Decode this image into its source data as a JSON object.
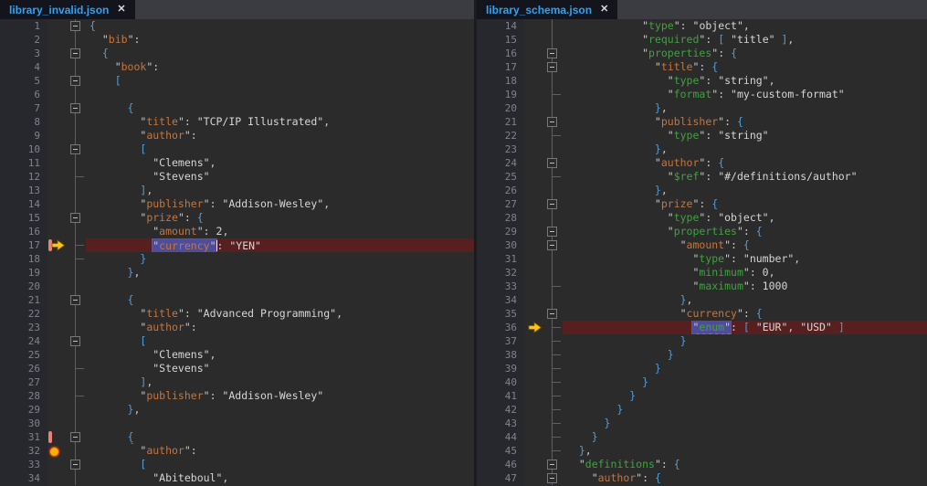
{
  "colors": {
    "editor-bg": "#2b2b2b",
    "gutter-bg": "#27272e",
    "tabstrip-bg": "#3b3b42",
    "tab-bg": "#14141c",
    "tab-text": "#2fa3f2",
    "divider": "#1a1a20",
    "line-number": "#82828e",
    "brace": "#569cd6",
    "key": "#c6763c",
    "schema-key": "#3fa33f",
    "string": "#d6d6d6",
    "punct": "#c9c9c9",
    "number": "#d6d6d6",
    "error-line-bg": "#571f1f",
    "selection-bg": "#4d4d9c",
    "squiggle": "#ff2a2a",
    "fold-line": "#5f5f5f",
    "glyph-bar": "#e8837c",
    "glyph-arrow": "#ffc20e",
    "glyph-dot": "#ffaf00",
    "caret": "#ffffff"
  },
  "panes": [
    {
      "id": "left",
      "tab": {
        "title": "library_invalid.json",
        "close": "✕"
      },
      "lines": [
        {
          "n": 1,
          "ind": 0,
          "fold": "open",
          "tok": [
            [
              "b",
              "{"
            ]
          ]
        },
        {
          "n": 2,
          "ind": 2,
          "tok": [
            [
              "k",
              "bib"
            ],
            [
              "q",
              ":"
            ]
          ]
        },
        {
          "n": 3,
          "ind": 2,
          "fold": "open",
          "tok": [
            [
              "b",
              "{"
            ]
          ]
        },
        {
          "n": 4,
          "ind": 4,
          "tok": [
            [
              "k",
              "book"
            ],
            [
              "q",
              ":"
            ]
          ]
        },
        {
          "n": 5,
          "ind": 4,
          "fold": "open",
          "tok": [
            [
              "b",
              "["
            ]
          ]
        },
        {
          "n": 6,
          "ind": 0,
          "tok": []
        },
        {
          "n": 7,
          "ind": 6,
          "fold": "open",
          "tok": [
            [
              "b",
              "{"
            ]
          ]
        },
        {
          "n": 8,
          "ind": 8,
          "tok": [
            [
              "k",
              "title"
            ],
            [
              "q",
              ": "
            ],
            [
              "v",
              "\"TCP/IP Illustrated\""
            ],
            [
              "q",
              ","
            ]
          ]
        },
        {
          "n": 9,
          "ind": 8,
          "tok": [
            [
              "k",
              "author"
            ],
            [
              "q",
              ":"
            ]
          ]
        },
        {
          "n": 10,
          "ind": 8,
          "fold": "open",
          "tok": [
            [
              "b",
              "["
            ]
          ]
        },
        {
          "n": 11,
          "ind": 10,
          "tok": [
            [
              "v",
              "\"Clemens\""
            ],
            [
              "q",
              ","
            ]
          ]
        },
        {
          "n": 12,
          "ind": 10,
          "fold": "tick",
          "tok": [
            [
              "v",
              "\"Stevens\""
            ]
          ]
        },
        {
          "n": 13,
          "ind": 8,
          "tok": [
            [
              "b",
              "]"
            ],
            [
              "q",
              ","
            ]
          ]
        },
        {
          "n": 14,
          "ind": 8,
          "tok": [
            [
              "k",
              "publisher"
            ],
            [
              "q",
              ": "
            ],
            [
              "v",
              "\"Addison-Wesley\""
            ],
            [
              "q",
              ","
            ]
          ]
        },
        {
          "n": 15,
          "ind": 8,
          "fold": "open",
          "tok": [
            [
              "k",
              "prize"
            ],
            [
              "q",
              ": "
            ],
            [
              "b",
              "{"
            ]
          ]
        },
        {
          "n": 16,
          "ind": 10,
          "tok": [
            [
              "k",
              "amount"
            ],
            [
              "q",
              ": "
            ],
            [
              "d",
              "2"
            ],
            [
              "q",
              ","
            ]
          ]
        },
        {
          "n": 17,
          "ind": 10,
          "fold": "tick",
          "hl": true,
          "glyphs": [
            "bar",
            "arrow"
          ],
          "tok": [
            [
              "k",
              "currency",
              "sel sq"
            ],
            [
              "caret",
              ""
            ],
            [
              "q",
              ": "
            ],
            [
              "v",
              "\"YEN\""
            ]
          ]
        },
        {
          "n": 18,
          "ind": 8,
          "fold": "tick",
          "tok": [
            [
              "b",
              "}"
            ]
          ]
        },
        {
          "n": 19,
          "ind": 6,
          "tok": [
            [
              "b",
              "}"
            ],
            [
              "q",
              ","
            ]
          ]
        },
        {
          "n": 20,
          "ind": 0,
          "tok": []
        },
        {
          "n": 21,
          "ind": 6,
          "fold": "open",
          "tok": [
            [
              "b",
              "{"
            ]
          ]
        },
        {
          "n": 22,
          "ind": 8,
          "tok": [
            [
              "k",
              "title"
            ],
            [
              "q",
              ": "
            ],
            [
              "v",
              "\"Advanced Programming\""
            ],
            [
              "q",
              ","
            ]
          ]
        },
        {
          "n": 23,
          "ind": 8,
          "tok": [
            [
              "k",
              "author"
            ],
            [
              "q",
              ":"
            ]
          ]
        },
        {
          "n": 24,
          "ind": 8,
          "fold": "open",
          "tok": [
            [
              "b",
              "["
            ]
          ]
        },
        {
          "n": 25,
          "ind": 10,
          "tok": [
            [
              "v",
              "\"Clemens\""
            ],
            [
              "q",
              ","
            ]
          ]
        },
        {
          "n": 26,
          "ind": 10,
          "fold": "tick",
          "tok": [
            [
              "v",
              "\"Stevens\""
            ]
          ]
        },
        {
          "n": 27,
          "ind": 8,
          "tok": [
            [
              "b",
              "]"
            ],
            [
              "q",
              ","
            ]
          ]
        },
        {
          "n": 28,
          "ind": 8,
          "fold": "tick",
          "tok": [
            [
              "k",
              "publisher"
            ],
            [
              "q",
              ": "
            ],
            [
              "v",
              "\"Addison-Wesley\""
            ]
          ]
        },
        {
          "n": 29,
          "ind": 6,
          "tok": [
            [
              "b",
              "}"
            ],
            [
              "q",
              ","
            ]
          ]
        },
        {
          "n": 30,
          "ind": 0,
          "tok": []
        },
        {
          "n": 31,
          "ind": 6,
          "fold": "open",
          "glyphs": [
            "bar"
          ],
          "tok": [
            [
              "b",
              "{",
              "sq"
            ]
          ]
        },
        {
          "n": 32,
          "ind": 8,
          "glyphs": [
            "dot"
          ],
          "tok": [
            [
              "k",
              "author"
            ],
            [
              "q",
              ":"
            ]
          ]
        },
        {
          "n": 33,
          "ind": 8,
          "fold": "open",
          "tok": [
            [
              "b",
              "["
            ]
          ]
        },
        {
          "n": 34,
          "ind": 10,
          "tok": [
            [
              "v",
              "\"Abiteboul\""
            ],
            [
              "q",
              ","
            ]
          ]
        }
      ]
    },
    {
      "id": "right",
      "tab": {
        "title": "library_schema.json",
        "close": "✕"
      },
      "lines": [
        {
          "n": 14,
          "ind": 12,
          "tok": [
            [
              "s",
              "type"
            ],
            [
              "q",
              ": "
            ],
            [
              "v",
              "\"object\""
            ],
            [
              "q",
              ","
            ]
          ]
        },
        {
          "n": 15,
          "ind": 12,
          "tok": [
            [
              "s",
              "required"
            ],
            [
              "q",
              ": "
            ],
            [
              "b",
              "["
            ],
            [
              "q",
              " "
            ],
            [
              "v",
              "\"title\""
            ],
            [
              "q",
              " "
            ],
            [
              "b",
              "]"
            ],
            [
              "q",
              ","
            ]
          ]
        },
        {
          "n": 16,
          "ind": 12,
          "fold": "open",
          "tok": [
            [
              "s",
              "properties"
            ],
            [
              "q",
              ": "
            ],
            [
              "b",
              "{"
            ]
          ]
        },
        {
          "n": 17,
          "ind": 14,
          "fold": "open",
          "tok": [
            [
              "k",
              "title"
            ],
            [
              "q",
              ": "
            ],
            [
              "b",
              "{"
            ]
          ]
        },
        {
          "n": 18,
          "ind": 16,
          "tok": [
            [
              "s",
              "type"
            ],
            [
              "q",
              ": "
            ],
            [
              "v",
              "\"string\""
            ],
            [
              "q",
              ","
            ]
          ]
        },
        {
          "n": 19,
          "ind": 16,
          "fold": "tick",
          "tok": [
            [
              "s",
              "format"
            ],
            [
              "q",
              ": "
            ],
            [
              "v",
              "\"my-custom-format\""
            ]
          ]
        },
        {
          "n": 20,
          "ind": 14,
          "tok": [
            [
              "b",
              "}"
            ],
            [
              "q",
              ","
            ]
          ]
        },
        {
          "n": 21,
          "ind": 14,
          "fold": "open",
          "tok": [
            [
              "k",
              "publisher"
            ],
            [
              "q",
              ": "
            ],
            [
              "b",
              "{"
            ]
          ]
        },
        {
          "n": 22,
          "ind": 16,
          "fold": "tick",
          "tok": [
            [
              "s",
              "type"
            ],
            [
              "q",
              ": "
            ],
            [
              "v",
              "\"string\""
            ]
          ]
        },
        {
          "n": 23,
          "ind": 14,
          "tok": [
            [
              "b",
              "}"
            ],
            [
              "q",
              ","
            ]
          ]
        },
        {
          "n": 24,
          "ind": 14,
          "fold": "open",
          "tok": [
            [
              "k",
              "author"
            ],
            [
              "q",
              ": "
            ],
            [
              "b",
              "{"
            ]
          ]
        },
        {
          "n": 25,
          "ind": 16,
          "fold": "tick",
          "tok": [
            [
              "s",
              "$ref"
            ],
            [
              "q",
              ": "
            ],
            [
              "v",
              "\"#/definitions/author\""
            ]
          ]
        },
        {
          "n": 26,
          "ind": 14,
          "tok": [
            [
              "b",
              "}"
            ],
            [
              "q",
              ","
            ]
          ]
        },
        {
          "n": 27,
          "ind": 14,
          "fold": "open",
          "tok": [
            [
              "k",
              "prize"
            ],
            [
              "q",
              ": "
            ],
            [
              "b",
              "{"
            ]
          ]
        },
        {
          "n": 28,
          "ind": 16,
          "tok": [
            [
              "s",
              "type"
            ],
            [
              "q",
              ": "
            ],
            [
              "v",
              "\"object\""
            ],
            [
              "q",
              ","
            ]
          ]
        },
        {
          "n": 29,
          "ind": 16,
          "fold": "open",
          "tok": [
            [
              "s",
              "properties"
            ],
            [
              "q",
              ": "
            ],
            [
              "b",
              "{"
            ]
          ]
        },
        {
          "n": 30,
          "ind": 18,
          "fold": "open",
          "tok": [
            [
              "k",
              "amount"
            ],
            [
              "q",
              ": "
            ],
            [
              "b",
              "{"
            ]
          ]
        },
        {
          "n": 31,
          "ind": 20,
          "tok": [
            [
              "s",
              "type"
            ],
            [
              "q",
              ": "
            ],
            [
              "v",
              "\"number\""
            ],
            [
              "q",
              ","
            ]
          ]
        },
        {
          "n": 32,
          "ind": 20,
          "tok": [
            [
              "s",
              "minimum"
            ],
            [
              "q",
              ": "
            ],
            [
              "d",
              "0"
            ],
            [
              "q",
              ","
            ]
          ]
        },
        {
          "n": 33,
          "ind": 20,
          "fold": "tick",
          "tok": [
            [
              "s",
              "maximum"
            ],
            [
              "q",
              ": "
            ],
            [
              "d",
              "1000"
            ]
          ]
        },
        {
          "n": 34,
          "ind": 18,
          "tok": [
            [
              "b",
              "}"
            ],
            [
              "q",
              ","
            ]
          ]
        },
        {
          "n": 35,
          "ind": 18,
          "fold": "open",
          "tok": [
            [
              "k",
              "currency"
            ],
            [
              "q",
              ": "
            ],
            [
              "b",
              "{"
            ]
          ]
        },
        {
          "n": 36,
          "ind": 20,
          "fold": "tick",
          "hl": true,
          "glyphs": [
            "arrow"
          ],
          "tok": [
            [
              "s",
              "enum",
              "sel sq"
            ],
            [
              "q",
              ": "
            ],
            [
              "b",
              "["
            ],
            [
              "q",
              " "
            ],
            [
              "v",
              "\"EUR\""
            ],
            [
              "q",
              ", "
            ],
            [
              "v",
              "\"USD\""
            ],
            [
              "q",
              " "
            ],
            [
              "b",
              "]"
            ]
          ]
        },
        {
          "n": 37,
          "ind": 18,
          "fold": "tick",
          "tok": [
            [
              "b",
              "}"
            ]
          ]
        },
        {
          "n": 38,
          "ind": 16,
          "fold": "tick",
          "tok": [
            [
              "b",
              "}"
            ]
          ]
        },
        {
          "n": 39,
          "ind": 14,
          "fold": "tick",
          "tok": [
            [
              "b",
              "}"
            ]
          ]
        },
        {
          "n": 40,
          "ind": 12,
          "fold": "tick",
          "tok": [
            [
              "b",
              "}"
            ]
          ]
        },
        {
          "n": 41,
          "ind": 10,
          "fold": "tick",
          "tok": [
            [
              "b",
              "}"
            ]
          ]
        },
        {
          "n": 42,
          "ind": 8,
          "fold": "tick",
          "tok": [
            [
              "b",
              "}"
            ]
          ]
        },
        {
          "n": 43,
          "ind": 6,
          "fold": "tick",
          "tok": [
            [
              "b",
              "}"
            ]
          ]
        },
        {
          "n": 44,
          "ind": 4,
          "fold": "tick",
          "tok": [
            [
              "b",
              "}"
            ]
          ]
        },
        {
          "n": 45,
          "ind": 2,
          "fold": "tick",
          "tok": [
            [
              "b",
              "}"
            ],
            [
              "q",
              ","
            ]
          ]
        },
        {
          "n": 46,
          "ind": 2,
          "fold": "open",
          "tok": [
            [
              "s",
              "definitions"
            ],
            [
              "q",
              ": "
            ],
            [
              "b",
              "{"
            ]
          ]
        },
        {
          "n": 47,
          "ind": 4,
          "fold": "open",
          "tok": [
            [
              "k",
              "author"
            ],
            [
              "q",
              ": "
            ],
            [
              "b",
              "{"
            ]
          ]
        }
      ]
    }
  ]
}
